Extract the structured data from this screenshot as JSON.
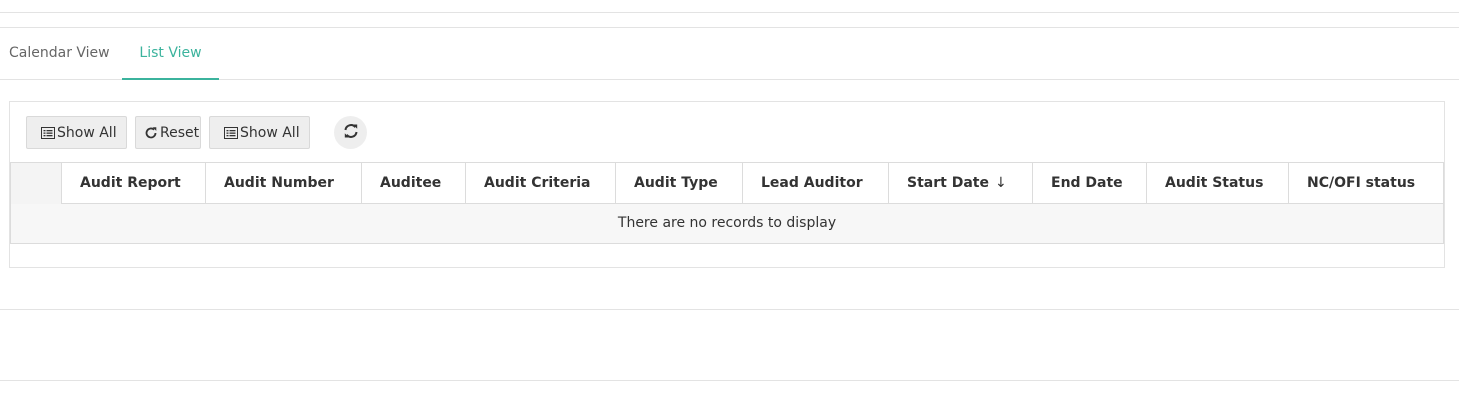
{
  "tabs": [
    {
      "label": "Calendar View",
      "active": false
    },
    {
      "label": "List View",
      "active": true
    }
  ],
  "toolbar": {
    "show_all_1": "Show All",
    "reset": "Reset",
    "show_all_2": "Show All",
    "icons": {
      "show_all": "list-icon",
      "reset": "reset-icon",
      "refresh": "refresh-icon"
    }
  },
  "table": {
    "columns": [
      "Audit Report",
      "Audit Number",
      "Auditee",
      "Audit Criteria",
      "Audit Type",
      "Lead Auditor",
      "Start Date",
      "End Date",
      "Audit Status",
      "NC/OFI status"
    ],
    "sorted_column": "Start Date",
    "sort_direction": "descending",
    "empty_message": "There are no records to display"
  },
  "colors": {
    "accent": "#3bb39d",
    "header_bg": "#f4f4f4"
  }
}
